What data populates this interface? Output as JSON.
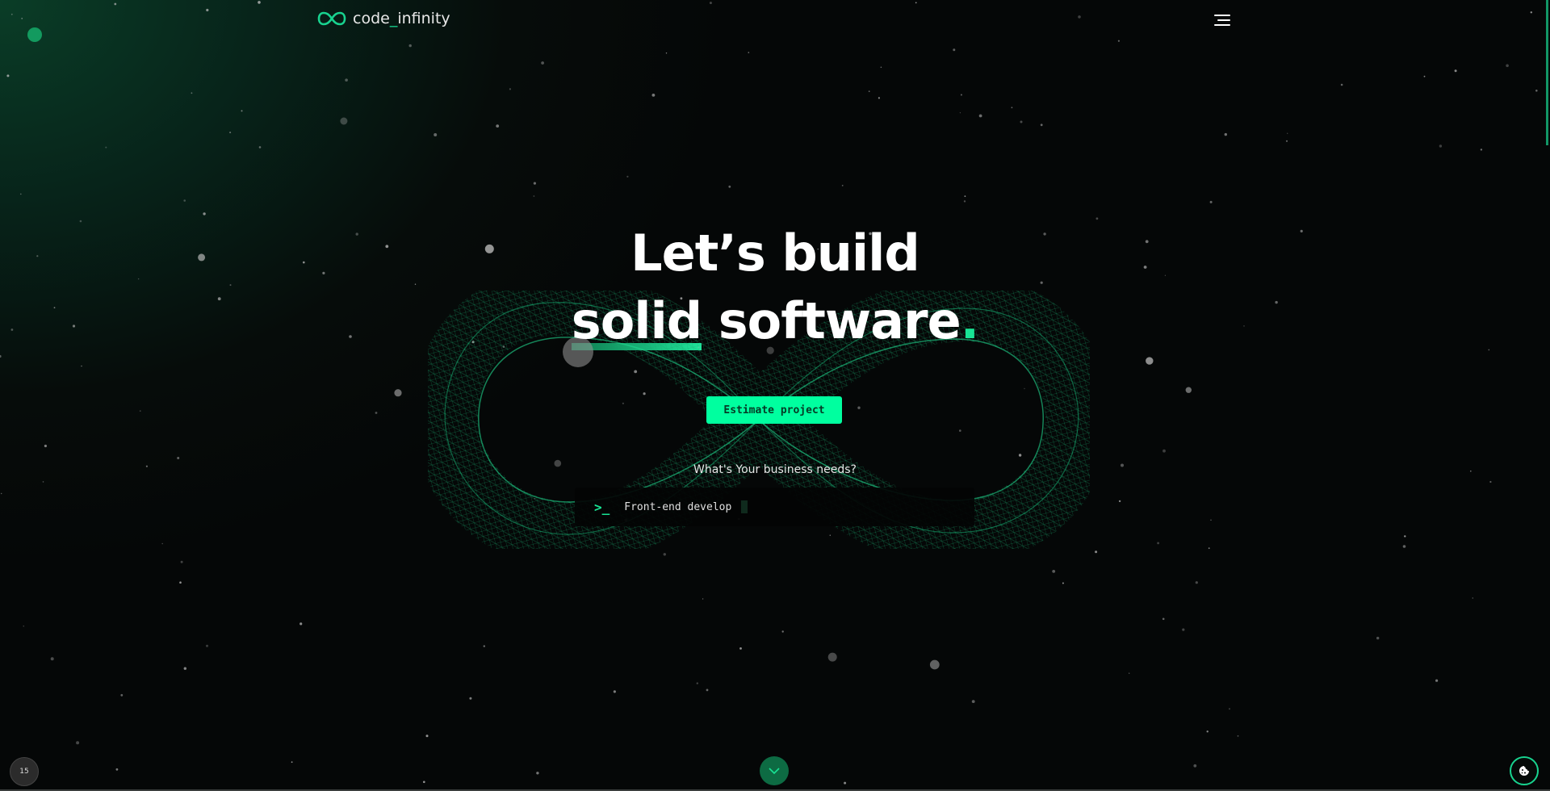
{
  "header": {
    "logo_prefix": "code",
    "logo_underscore": "_",
    "logo_suffix": "infinity",
    "menu_icon": "hamburger-menu-icon"
  },
  "hero": {
    "headline_line1": "Let’s build",
    "headline_word_highlight": "solid",
    "headline_word2": "software",
    "headline_period": ".",
    "cta_label": "Estimate project",
    "question": "What's Your business needs?",
    "terminal_prompt": ">_",
    "terminal_text": "Front-end develop"
  },
  "footer_controls": {
    "page_number": "15",
    "scroll_down_icon": "chevron-down-icon",
    "cookie_icon": "cookie-icon"
  },
  "colors": {
    "accent": "#00ff9f",
    "accent_dark": "#0d6b43",
    "background": "#050707"
  }
}
